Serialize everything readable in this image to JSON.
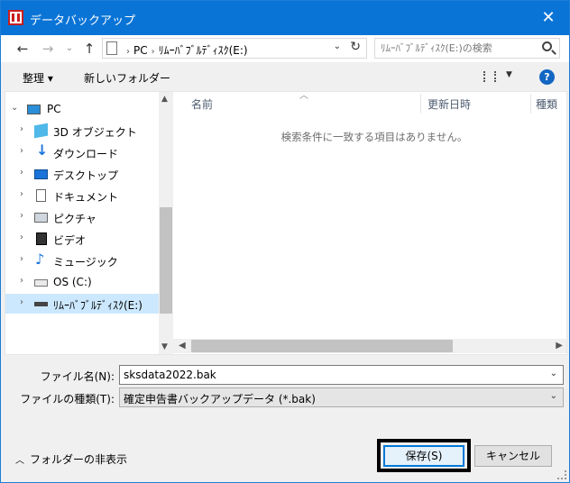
{
  "window": {
    "title": "データバックアップ",
    "close_glyph": "✕"
  },
  "nav": {
    "back": "←",
    "forward": "→",
    "recent": "⌄",
    "up": "↑"
  },
  "address": {
    "crumbs": [
      "PC",
      "ﾘﾑｰﾊﾞﾌﾞﾙﾃﾞｨｽｸ(E:)"
    ],
    "separator": "›",
    "refresh": "↻",
    "dropdown": "⌄"
  },
  "search": {
    "placeholder": "ﾘﾑｰﾊﾞﾌﾞﾙﾃﾞｨｽｸ(E:)の検索"
  },
  "toolbar": {
    "organize_label": "整理 ▾",
    "new_folder_label": "新しいフォルダー",
    "view_dropdown": "▼",
    "help_label": "?"
  },
  "tree": {
    "items": [
      {
        "label": "PC",
        "icon": "pc-icon"
      },
      {
        "label": "3D オブジェクト",
        "icon": "3d-objects-icon"
      },
      {
        "label": "ダウンロード",
        "icon": "downloads-icon"
      },
      {
        "label": "デスクトップ",
        "icon": "desktop-icon"
      },
      {
        "label": "ドキュメント",
        "icon": "documents-icon"
      },
      {
        "label": "ピクチャ",
        "icon": "pictures-icon"
      },
      {
        "label": "ビデオ",
        "icon": "videos-icon"
      },
      {
        "label": "ミュージック",
        "icon": "music-icon"
      },
      {
        "label": "OS (C:)",
        "icon": "os-drive-icon"
      },
      {
        "label": "ﾘﾑｰﾊﾞﾌﾞﾙﾃﾞｨｽｸ(E:)",
        "icon": "removable-disk-icon"
      }
    ],
    "expanded_arrow": "⌄",
    "collapsed_arrow": "›"
  },
  "filelist": {
    "columns": [
      "名前",
      "更新日時",
      "種類"
    ],
    "empty_message": "検索条件に一致する項目はありません。"
  },
  "form": {
    "filename_label": "ファイル名(N):",
    "filename_value": "sksdata2022.bak",
    "filetype_label": "ファイルの種類(T):",
    "filetype_value": "確定申告書バックアップデータ (*.bak)"
  },
  "footer": {
    "hide_folders_label": "フォルダーの非表示",
    "save_label": "保存(S)",
    "cancel_label": "キャンセル"
  }
}
